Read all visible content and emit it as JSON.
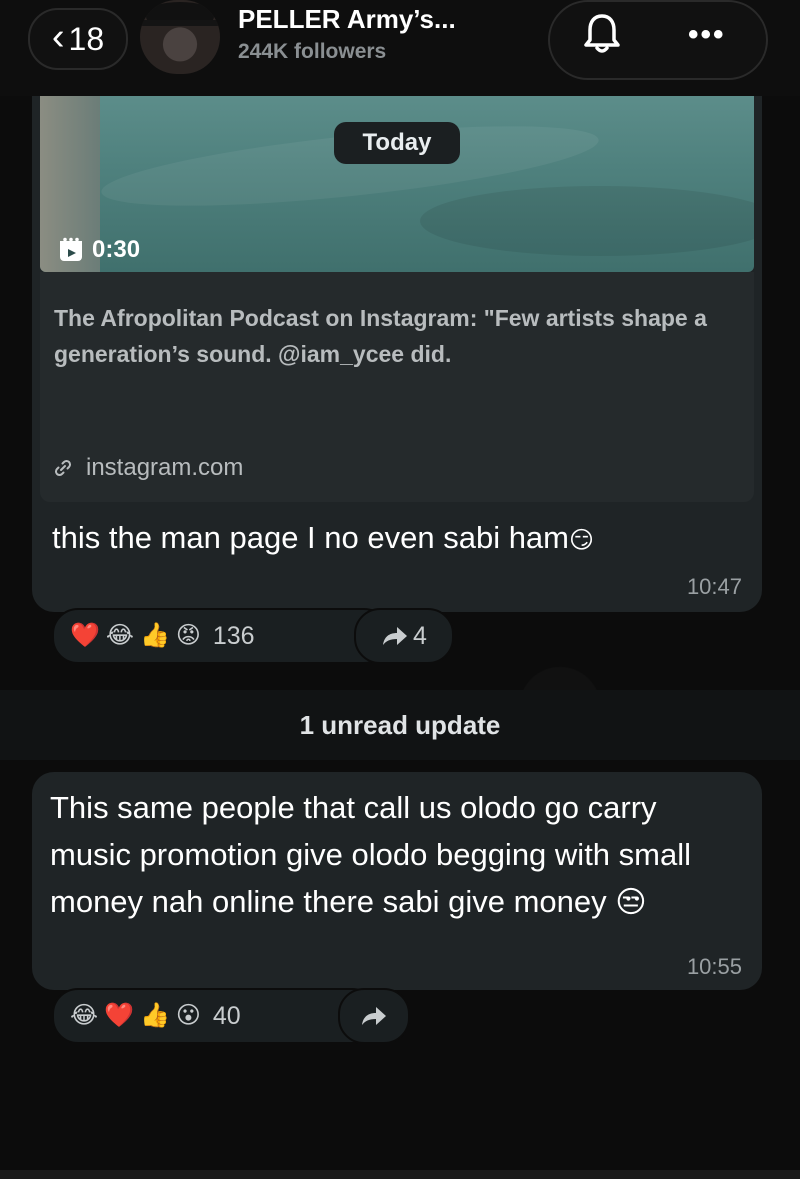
{
  "header": {
    "back_count": "18",
    "channel_name": "PELLER Army’s...",
    "followers": "244K followers",
    "back_icon": "chevron-left-icon",
    "bell_icon": "bell-icon",
    "more_icon": "more-dots-icon",
    "more_label": "•••"
  },
  "date_pill": "Today",
  "message1": {
    "video_duration": "0:30",
    "link_title": "The Afropolitan Podcast on Instagram: \"Few artists shape a generation’s sound. @iam_ycee did.",
    "link_domain": "instagram.com",
    "text": "this the man page I no even sabi ham",
    "text_emoji": "😏",
    "time": "10:47",
    "reactions": {
      "emojis": [
        "❤️",
        "😂",
        "👍",
        "😡"
      ],
      "count": "136"
    },
    "forwards": "4"
  },
  "unread_divider": "1 unread update",
  "message2": {
    "text": "This same people that call us olodo go carry music promotion give olodo begging with small money nah online there sabi give money",
    "text_emoji": "😒",
    "time": "10:55",
    "reactions": {
      "emojis": [
        "😂",
        "❤️",
        "👍",
        "😮"
      ],
      "count": "40"
    }
  },
  "colors": {
    "background": "#0c0c0c",
    "bubble": "#1f2426",
    "video_teal": "#4f817e",
    "muted_text": "#9aa0a3"
  }
}
